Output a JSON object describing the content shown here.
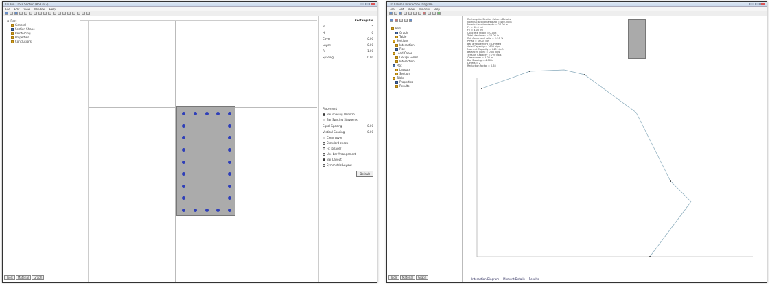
{
  "left_window": {
    "title": "TD  Run Cross Section (Pb8 in 2)",
    "menu": [
      "File",
      "Edit",
      "View",
      "Window",
      "Help"
    ],
    "tree": [
      "Rect",
      "General",
      "Section Shape",
      "Reinforcing",
      "Properties",
      "Conclusions"
    ],
    "tabs": [
      "Tools",
      "Material",
      "Graph"
    ],
    "panel": {
      "heading": "Rectangular",
      "labels": [
        "B",
        "H",
        "Cover",
        "Layers",
        "R",
        "Spacing"
      ],
      "values": [
        "5",
        "0",
        "0.00",
        "0.00",
        "1.00",
        "0.00"
      ],
      "options_heading": "Placement",
      "options": [
        "Bar spacing Uniform",
        "Bar Spacing Staggered",
        "Equal Spacing",
        "Vertical Spacing"
      ],
      "spacing_values": [
        "0.00",
        "0.00"
      ],
      "checks": [
        "Clear cover",
        "Standard check",
        "Fit to layer",
        "Use bar Arrangement",
        "Bar Layout",
        "Symmetric Layout"
      ],
      "button": "Default"
    }
  },
  "right_window": {
    "title": "TD  Column Interaction Diagram",
    "menu": [
      "File",
      "Edit",
      "View",
      "Window",
      "Help"
    ],
    "tree": [
      "Root",
      "Graph",
      "Table",
      "Sections",
      "Interaction",
      "Plot",
      "Load Cases",
      "Design Forms",
      "Interaction",
      "Plot",
      "Layouts",
      "Section",
      "Table",
      "Properties",
      "Results"
    ],
    "tabs": [
      "Tools",
      "Material",
      "Graph"
    ],
    "info_lines": [
      "Rectangular Section Column Details",
      "Nominal section area  Ag = 480.00 in",
      "Nominal section depth = 24.00 in",
      "Fy = 60.0 ksi",
      "f'c = 4.00 ksi",
      "Concrete Strain = 0.003",
      "Total steel area = 12.00 in",
      "Reinforcement ratio = 2.50 %",
      "Pmax = 1600 kips",
      "Bar arrangement = Layered",
      "Axial Capacity = 1600 kips",
      "Moment Capacity = 640 kip-ft",
      "Balanced point = 0.00 kips",
      "Tension Capacity = 720 kips",
      "Clear cover = 2.00 in",
      "Bar Spacing = 4.00 in",
      "Layers = 2",
      "Reduction factor = 0.65"
    ],
    "bottom_links": [
      "Interaction Diagram",
      "Moment Details",
      "Results"
    ]
  }
}
